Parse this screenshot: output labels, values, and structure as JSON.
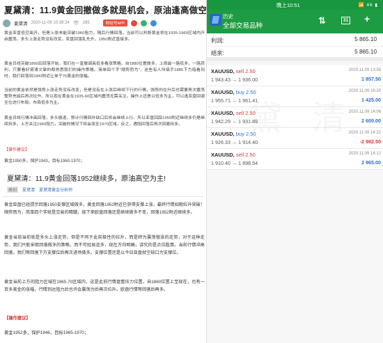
{
  "article": {
    "title": "夏黛清：11.9黄金回撤做多就是机会，原油逢高做空!",
    "author": "夏黛清",
    "date": "2020-11-09 10:39:24",
    "views": "295",
    "app_button": "财经号APP",
    "paragraphs": [
      "黄金亚盘低空高开，但是上涨未能突破1960阻力，随后行情回落，当前可以判断黄金将在1935-1960区域内开启震荡。多头上涨走势没有改变，亚盘回落乱先升，1950附近直接多。",
      "黄金日线突破1890后回落开始，我们在一直撤调高低多看涨策略。自1880位置做多，上周最一路低多，一路获利，只要看好黛清文章的都熟悉我们的操作策略。简单四个字\"顺势而为\"，这些有人叫搞手1885下力暗看到时，我们回落到1900附近让单子70美金的涨幅。",
      "当前的黄金依然是强势上涨走势没有改变，但是没有在上涨后继续下行的行情，强势的拉升后也需要再次震荡整势充能后再次拉升。所以现在黄金在1935-60区域内震荡无需关注，操作上还是以低多为主，可以逢亚盘回调至位进行布局，布局低多为主。",
      "黄金日线行情冲高回落，多头撤退，预计行情回补缺口后将会继续上行。所以亚盘回踩1950附近继续多仍是继续持多，上方关注1960阻力，突破的情况下将会涨至1970区域，反之，遇阻回落后再次回撤持多。"
    ],
    "op_label": "【操作建议】",
    "plan": "黄金1950多，保护1943，目标1960-1970；",
    "second_title": "夏黛清：11.9黄金回落1952继续多，原油高空为主!",
    "tag": "原创",
    "sub_author": "夏黛清",
    "sub_source": "夏黛清黄金分析师",
    "paragraphs2": [
      "黄金亚盘已经提示回落1950支撑区域做多，黄金回落1952附近已获得支撑上涨，最终行情如期拉升突破！顺势而为，简单四个字就是交易的精髓，接下来欧盘回落还是继续做多不变，回落1952附近继续多。",
      "黄金当前当前就是多头上涨走势，但是不同于此前极性的拉升，而是转为震荡慢涨的走势，对于这种走势，我们只能采取回落做多的策略，而不可轻易追多，现在方向明确，讲究的是点位胜算。当前行情冲高回落，我们等回落下方支撑位后再次进场做多。支撑位置还是以今日亚盘就空缺口为支撑位。",
      "黄金当前上方的阻力区域在1965-70区域内，这是此前行情盘整压力位置，自1860位置上至现在，也有一百多美金的涨幅，行情到达阻力后也许会震荡为后再次拉升。欧盘行情等回落后再多。"
    ],
    "op_label2": "【操作建议】",
    "plan2": "黄金1952多，保护1946，目标1965-1970；"
  },
  "statusbar": {
    "time": "晚上10:51",
    "signal": "📶 46 ▮"
  },
  "app": {
    "title": "历史",
    "subtitle": "全部交易品种",
    "calendar_label": "31"
  },
  "summary": {
    "profit_label": "利润:",
    "profit_value": "5 865.10",
    "balance_label": "结余:",
    "balance_value": "5 865.10"
  },
  "trades": [
    {
      "symbol": "XAUUSD,",
      "side": "sell 2.50",
      "side_type": "sell",
      "prices": "1 943.43 → 1 936.00",
      "date": "2020.11.09 13:59",
      "pl": "1 857.50",
      "pl_type": "pos"
    },
    {
      "symbol": "XAUUSD,",
      "side": "buy 2.50",
      "side_type": "buy",
      "prices": "1 955.71 → 1 961.41",
      "date": "2020.11.09 16:20",
      "pl": "1 425.00",
      "pl_type": "pos"
    },
    {
      "symbol": "XAUUSD,",
      "side": "sell 2.50",
      "side_type": "sell",
      "prices": "1 942.29 → 1 931.89",
      "date": "2020.11.09 14:06",
      "pl": "2 600.00",
      "pl_type": "pos"
    },
    {
      "symbol": "XAUUSD,",
      "side": "buy 2.50",
      "side_type": "buy",
      "prices": "1 926.33 → 1 914.40",
      "date": "2020.11.09 14:22",
      "pl": "-2 982.50",
      "pl_type": "neg"
    },
    {
      "symbol": "XAUUSD,",
      "side": "sell 2.50",
      "side_type": "sell",
      "prices": "1 910.40 → 1 898.54",
      "date": "2020.11.09 14:12",
      "pl": "2 965.00",
      "pl_type": "pos"
    }
  ],
  "colors": {
    "accent_green": "#1e9c43",
    "sell_red": "#d93636",
    "buy_blue": "#2a6fd0"
  },
  "icons": [
    "sort-icon",
    "calendar-icon",
    "new-trade-icon"
  ]
}
